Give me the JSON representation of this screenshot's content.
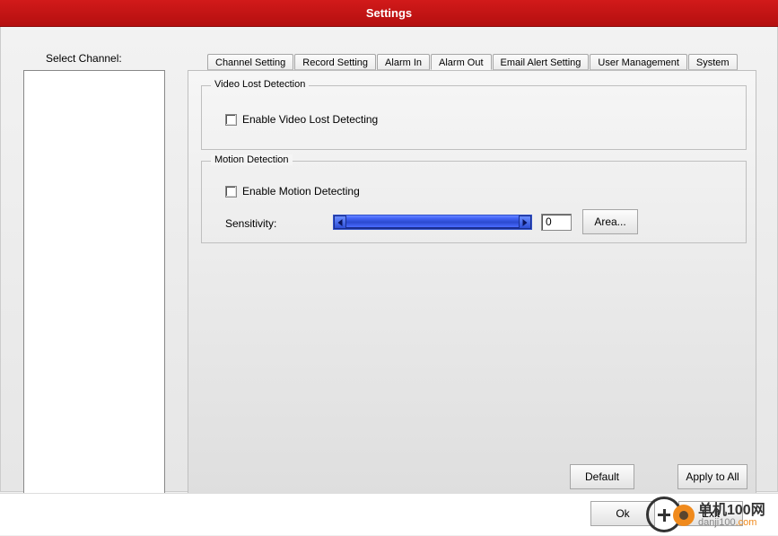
{
  "title": "Settings",
  "sidebar": {
    "label": "Select Channel:"
  },
  "tabs": [
    {
      "label": "Channel Setting",
      "active": false
    },
    {
      "label": "Record Setting",
      "active": false
    },
    {
      "label": "Alarm In",
      "active": false
    },
    {
      "label": "Alarm Out",
      "active": true
    },
    {
      "label": "Email Alert Setting",
      "active": false
    },
    {
      "label": "User Management",
      "active": false
    },
    {
      "label": "System",
      "active": false
    }
  ],
  "videoLost": {
    "legend": "Video Lost Detection",
    "enable_label": "Enable Video Lost Detecting",
    "enable_checked": false
  },
  "motion": {
    "legend": "Motion Detection",
    "enable_label": "Enable Motion Detecting",
    "enable_checked": false,
    "sensitivity_label": "Sensitivity:",
    "sensitivity_value": "0",
    "area_button": "Area..."
  },
  "buttons": {
    "default": "Default",
    "apply_all": "Apply to All",
    "ok": "Ok",
    "exit": "Exit"
  },
  "watermark": {
    "brand": "单机100网",
    "url_prefix": "danji100",
    "url_suffix": ".com"
  }
}
